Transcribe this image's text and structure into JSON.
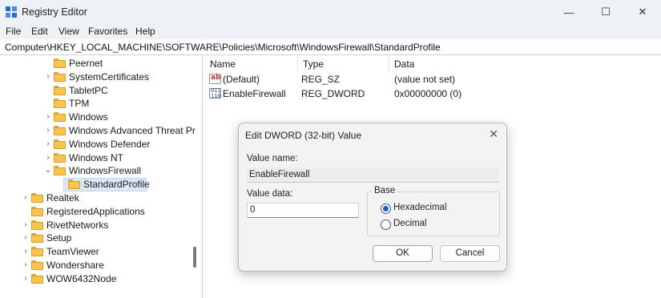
{
  "window": {
    "title": "Registry Editor",
    "minimize_glyph": "—",
    "maximize_glyph": "☐",
    "close_glyph": "✕"
  },
  "menu": [
    "File",
    "Edit",
    "View",
    "Favorites",
    "Help"
  ],
  "address": "Computer\\HKEY_LOCAL_MACHINE\\SOFTWARE\\Policies\\Microsoft\\WindowsFirewall\\StandardProfile",
  "tree": [
    {
      "label": "Peernet",
      "chevron": "",
      "depth": 2
    },
    {
      "label": "SystemCertificates",
      "chevron": "›",
      "depth": 2
    },
    {
      "label": "TabletPC",
      "chevron": "",
      "depth": 2
    },
    {
      "label": "TPM",
      "chevron": "",
      "depth": 2
    },
    {
      "label": "Windows",
      "chevron": "›",
      "depth": 2
    },
    {
      "label": "Windows Advanced Threat Pr",
      "chevron": "›",
      "depth": 2
    },
    {
      "label": "Windows Defender",
      "chevron": "›",
      "depth": 2
    },
    {
      "label": "Windows NT",
      "chevron": "›",
      "depth": 2
    },
    {
      "label": "WindowsFirewall",
      "chevron": "⌄",
      "depth": 2
    },
    {
      "label": "StandardProfile",
      "chevron": "",
      "depth": 3,
      "selected": true
    },
    {
      "label": "Realtek",
      "chevron": "›",
      "depth": 1
    },
    {
      "label": "RegisteredApplications",
      "chevron": "",
      "depth": 1
    },
    {
      "label": "RivetNetworks",
      "chevron": "›",
      "depth": 1
    },
    {
      "label": "Setup",
      "chevron": "›",
      "depth": 1
    },
    {
      "label": "TeamViewer",
      "chevron": "›",
      "depth": 1
    },
    {
      "label": "Wondershare",
      "chevron": "›",
      "depth": 1
    },
    {
      "label": "WOW6432Node",
      "chevron": "›",
      "depth": 1
    }
  ],
  "list": {
    "headers": [
      "Name",
      "Type",
      "Data"
    ],
    "rows": [
      {
        "icon": "string-value-icon",
        "icon_text": "ab",
        "name": "(Default)",
        "type": "REG_SZ",
        "data": "(value not set)"
      },
      {
        "icon": "binary-value-icon",
        "icon_text": "011\n110",
        "name": "EnableFirewall",
        "type": "REG_DWORD",
        "data": "0x00000000 (0)"
      }
    ]
  },
  "dialog": {
    "title": "Edit DWORD (32-bit) Value",
    "close_glyph": "✕",
    "value_name_label": "Value name:",
    "value_name": "EnableFirewall",
    "value_data_label": "Value data:",
    "value_data": "0",
    "base_label": "Base",
    "base_options": [
      {
        "label": "Hexadecimal",
        "checked": true
      },
      {
        "label": "Decimal",
        "checked": false
      }
    ],
    "ok_label": "OK",
    "cancel_label": "Cancel"
  },
  "colors": {
    "chrome_bg": "#eef1f6",
    "folder": "#f6c451",
    "selection": "#dde8f7",
    "accent": "#1f5fb4"
  }
}
